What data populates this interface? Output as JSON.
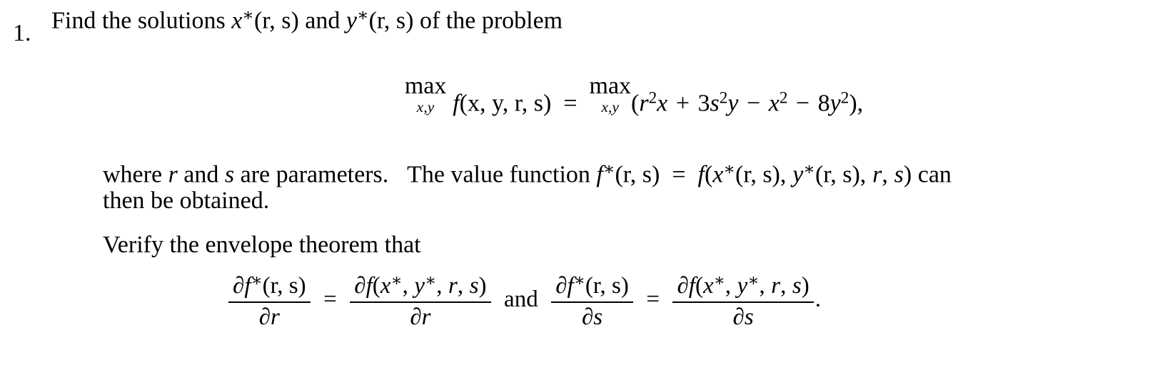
{
  "document": {
    "type": "math-exercise",
    "background_color": "#ffffff",
    "text_color": "#000000"
  },
  "exercise": {
    "number": "1.",
    "intro": {
      "before_x": "Find the solutions ",
      "x_star": "x",
      "x_args": "(r, s)",
      "and": " and ",
      "y_star": "y",
      "y_args": "(r, s)",
      "after": " of the problem"
    },
    "equation_1": {
      "max_label": "max",
      "max_limits": "x,y",
      "f_symbol": "f",
      "f_args": "(x, y, r, s)",
      "equals": "=",
      "max_label_2": "max",
      "max_limits_2": "x,y",
      "open_paren": "(",
      "term_1_base": "r",
      "term_1_exp": "2",
      "term_1_var": "x",
      "plus": "+",
      "term_2_coef": "3",
      "term_2_base": "s",
      "term_2_exp": "2",
      "term_2_var": "y",
      "minus_1": "−",
      "term_3_var": "x",
      "term_3_exp": "2",
      "minus_2": "−",
      "term_4_coef": "8",
      "term_4_var": "y",
      "term_4_exp": "2",
      "close_paren": ")",
      "comma": ","
    },
    "paragraph_where": {
      "seg_1": "where ",
      "var_r": "r",
      "seg_2": " and ",
      "var_s": "s",
      "seg_3": " are parameters.",
      "seg_4": "The value function ",
      "fstar": "f",
      "fstar_args": "(r, s)",
      "equals": "=",
      "f_sym": "f",
      "f_open": "(",
      "x_star": "x",
      "x_args": "(r, s)",
      "comma_1": ",",
      "y_star": "y",
      "y_args": "(r, s)",
      "comma_2": ",",
      "r_sym": "r",
      "comma_3": ",",
      "s_sym": "s",
      "f_close": ")",
      "seg_5": " can"
    },
    "paragraph_then": "then be obtained.",
    "paragraph_verify": "Verify the envelope theorem that",
    "equation_2": {
      "frac_1": {
        "numerator_partial": "∂",
        "numerator_f": "f",
        "numerator_args": "(r, s)",
        "denominator_partial": "∂",
        "denominator_var": "r"
      },
      "equals_1": "=",
      "frac_2": {
        "numerator_partial": "∂",
        "numerator_f": "f",
        "numerator_open": "(",
        "numerator_x": "x",
        "numerator_comma_1": ",",
        "numerator_y": "y",
        "numerator_comma_2": ",",
        "numerator_r": "r",
        "numerator_comma_3": ",",
        "numerator_s": "s",
        "numerator_close": ")",
        "denominator_partial": "∂",
        "denominator_var": "r"
      },
      "conjunction": "and",
      "frac_3": {
        "numerator_partial": "∂",
        "numerator_f": "f",
        "numerator_args": "(r, s)",
        "denominator_partial": "∂",
        "denominator_var": "s"
      },
      "equals_2": "=",
      "frac_4": {
        "numerator_partial": "∂",
        "numerator_f": "f",
        "numerator_open": "(",
        "numerator_x": "x",
        "numerator_comma_1": ",",
        "numerator_y": "y",
        "numerator_comma_2": ",",
        "numerator_r": "r",
        "numerator_comma_3": ",",
        "numerator_s": "s",
        "numerator_close": ")",
        "denominator_partial": "∂",
        "denominator_var": "s"
      },
      "period": "."
    },
    "symbols": {
      "star": "∗",
      "superscript_two": "2"
    }
  }
}
